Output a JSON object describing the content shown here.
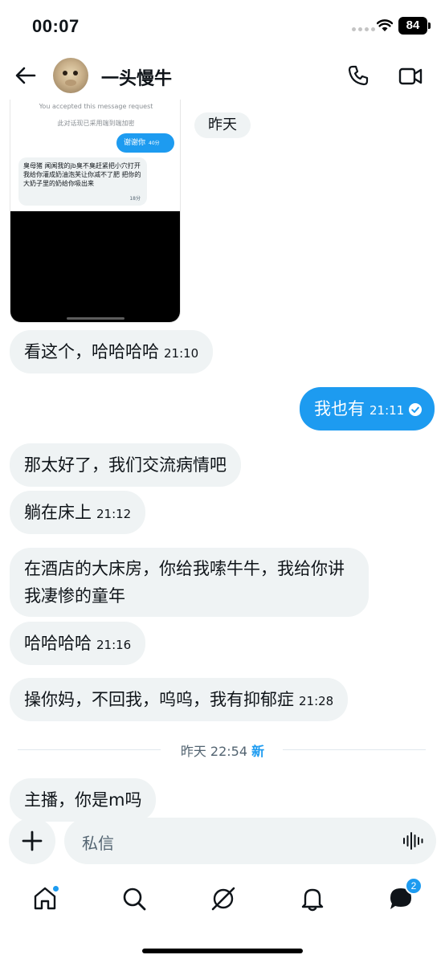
{
  "status_bar": {
    "time": "00:07",
    "battery": "84"
  },
  "header": {
    "contact_name": "一头慢牛"
  },
  "shared_screenshot": {
    "accepted_notice": "You accepted this message request",
    "encryption_notice": "此对话现已采用端到端加密",
    "sent_message": "谢谢你",
    "sent_time": "40分",
    "received_message": "臭母猪 闻闻我的jb臭不臭赶紧把小穴打开 我给你灌成奶油泡芙让你减不了肥 把你的大奶子里的奶给你吸出来",
    "received_time": "18分"
  },
  "day_chip": "昨天",
  "messages": [
    {
      "text": "看这个，哈哈哈哈",
      "time": "21:10"
    },
    {
      "text": "我也有",
      "time": "21:11"
    },
    {
      "text": "那太好了，我们交流病情吧",
      "time": ""
    },
    {
      "text": "躺在床上",
      "time": "21:12"
    },
    {
      "text": "在酒店的大床房，你给我嗦牛牛，我给你讲我凄惨的童年",
      "time": ""
    },
    {
      "text": "哈哈哈哈",
      "time": "21:16"
    },
    {
      "text": "操你妈，不回我，呜呜，我有抑郁症",
      "time": "21:28"
    },
    {
      "text": "主播，你是m吗",
      "time": ""
    }
  ],
  "divider": {
    "text": "昨天 22:54",
    "new_label": "新"
  },
  "composer": {
    "placeholder": "私信"
  },
  "tab_bar": {
    "messages_badge": "2"
  },
  "colors": {
    "accent": "#1d9bf0",
    "bubble_gray": "#eff3f4"
  }
}
